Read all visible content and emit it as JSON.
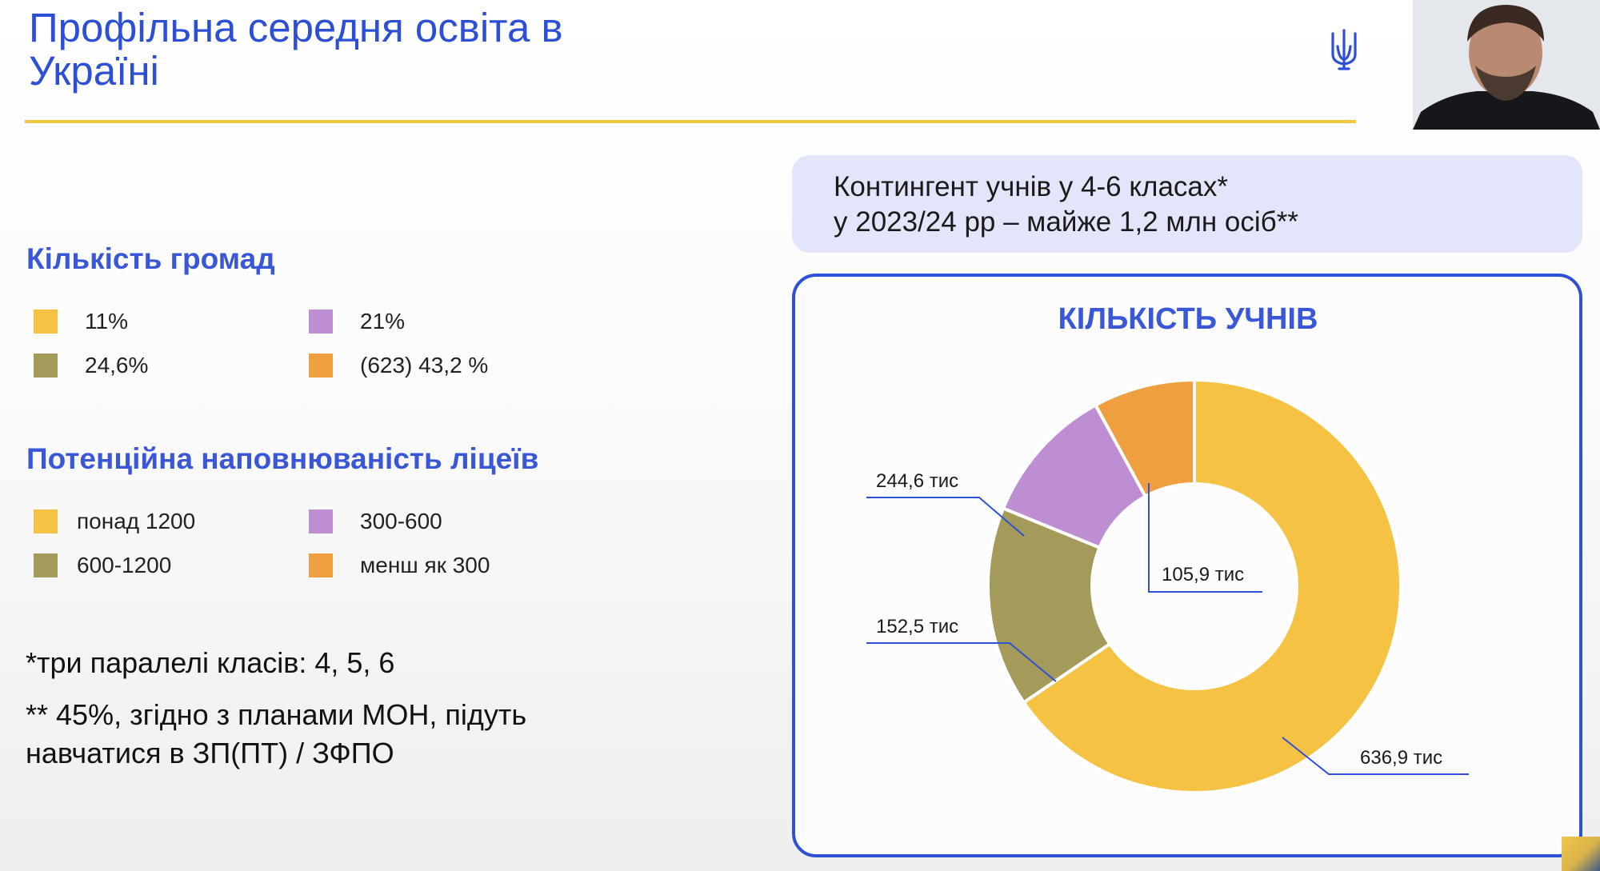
{
  "slide": {
    "title": "Профільна середня освіта в Україні"
  },
  "communities": {
    "heading": "Кількість громад",
    "items": [
      {
        "label": "11%",
        "color": "#f5c244"
      },
      {
        "label": "21%",
        "color": "#be8ed3"
      },
      {
        "label": "24,6%",
        "color": "#a49a5a"
      },
      {
        "label": "(623) 43,2 %",
        "color": "#ef9f40"
      }
    ]
  },
  "lyceums": {
    "heading": "Потенційна наповнюваність ліцеїв",
    "items": [
      {
        "label": "понад 1200",
        "color": "#f5c244"
      },
      {
        "label": "300-600",
        "color": "#be8ed3"
      },
      {
        "label": "600-1200",
        "color": "#a49a5a"
      },
      {
        "label": "менш як 300",
        "color": "#ef9f40"
      }
    ]
  },
  "notes": {
    "note1": "*три паралелі класів: 4, 5, 6",
    "note2_line1": "** 45%, згідно з планами МОН, підуть",
    "note2_line2": "навчатися в ЗП(ПТ) / ЗФПО"
  },
  "info_box": {
    "line1": "Контингент учнів у 4-6 класах*",
    "line2": "у 2023/24 рр – майже 1,2 млн осіб**"
  },
  "chart_data": {
    "type": "pie",
    "title": "КІЛЬКІСТЬ УЧНІВ",
    "donut": true,
    "unit": "тис",
    "slices": [
      {
        "value": 636.9,
        "label": "636,9 тис",
        "color": "#f5c244"
      },
      {
        "value": 152.5,
        "label": "152,5 тис",
        "color": "#a49a5a"
      },
      {
        "value": 105.9,
        "label": "244,6 тис",
        "color": "#be8ed3"
      },
      {
        "value": 77.3,
        "label": "105,9 тис",
        "color": "#ef9f40"
      }
    ]
  }
}
